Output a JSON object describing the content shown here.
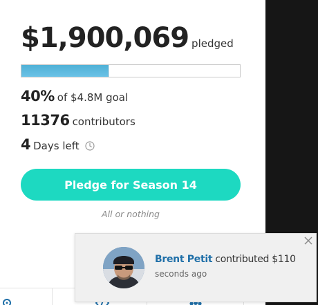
{
  "campaign": {
    "amount": "$1,900,069",
    "amount_suffix": "pledged",
    "progress_fraction": 0.4,
    "percent": "40%",
    "goal_text": "of $4.8M goal",
    "contributors_count": "11376",
    "contributors_label": "contributors",
    "days_left": "4",
    "days_label": "Days left",
    "cta_label": "Pledge for Season 14",
    "funding_note": "All or nothing"
  },
  "notification": {
    "name": "Brent Petit",
    "action": "contributed $110",
    "time": "seconds ago"
  },
  "colors": {
    "accent": "#1dd9c1",
    "progress": "#5ab8df",
    "link": "#1f6fa8",
    "dark_panel": "#161616"
  },
  "icons": [
    "clock-icon",
    "close-icon",
    "bottom-strip-icon"
  ]
}
